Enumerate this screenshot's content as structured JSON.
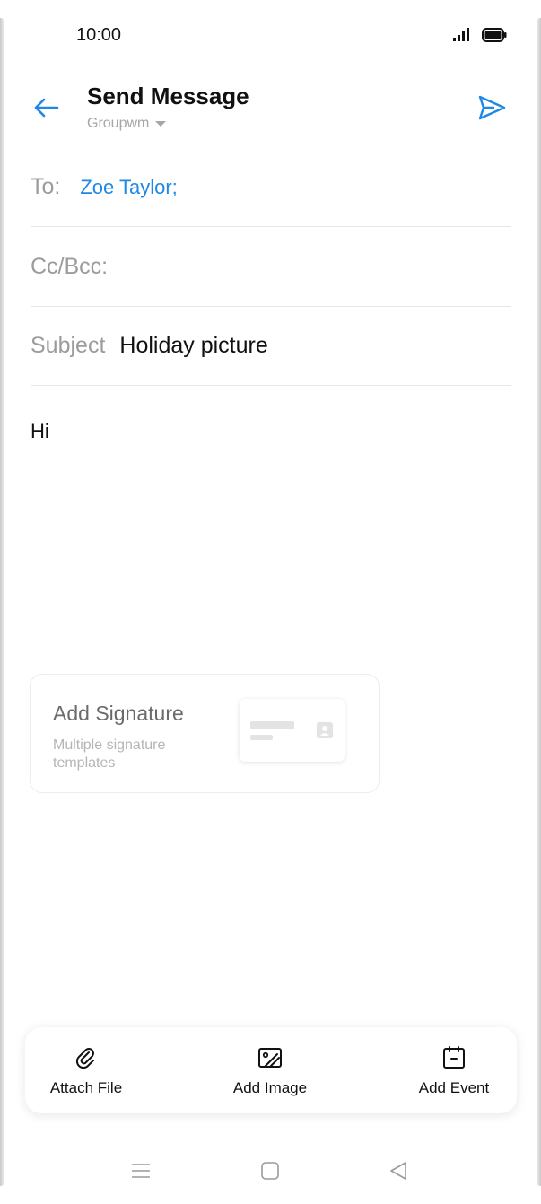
{
  "status_bar": {
    "time": "10:00"
  },
  "header": {
    "title": "Send Message",
    "account": "Groupwm"
  },
  "fields": {
    "to_label": "To:",
    "to_value": "Zoe Taylor;",
    "cc_label": "Cc/Bcc:",
    "subject_label": "Subject",
    "subject_value": "Holiday picture"
  },
  "body": {
    "text": "Hi"
  },
  "signature": {
    "title": "Add Signature",
    "subtitle": "Multiple signature templates"
  },
  "toolbar": {
    "attach_label": "Attach File",
    "image_label": "Add Image",
    "event_label": "Add Event"
  },
  "colors": {
    "accent": "#1e88e5",
    "label_gray": "#9c9c9c"
  },
  "icons": [
    "back-arrow-icon",
    "send-icon",
    "caret-down-icon",
    "paperclip-icon",
    "image-icon",
    "calendar-icon",
    "signal-icon",
    "battery-icon",
    "contact-icon",
    "menu-icon",
    "home-icon",
    "nav-back-icon"
  ]
}
